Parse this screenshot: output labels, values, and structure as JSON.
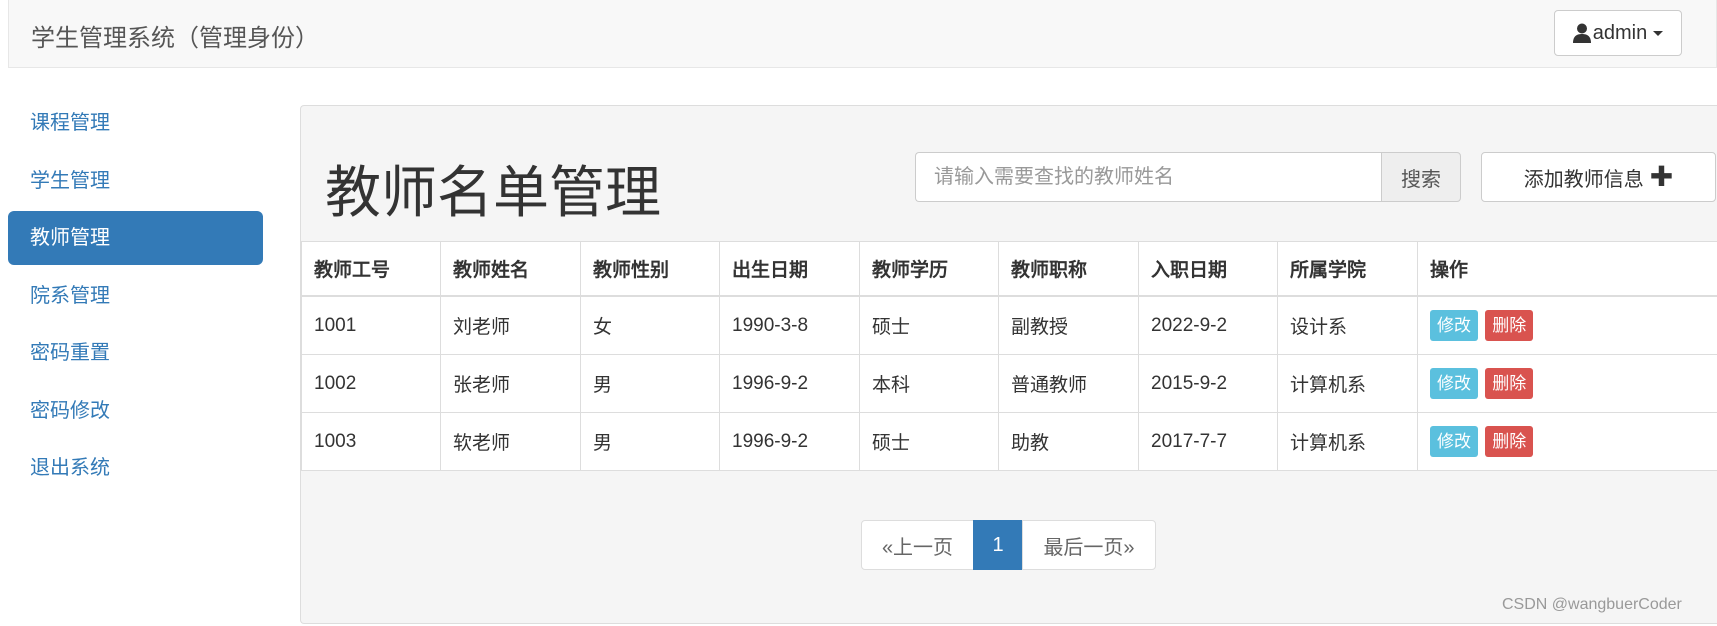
{
  "navbar": {
    "brand": "学生管理系统（管理身份）",
    "user": "admin"
  },
  "sidebar": {
    "items": [
      {
        "label": "课程管理"
      },
      {
        "label": "学生管理"
      },
      {
        "label": "教师管理",
        "active": true
      },
      {
        "label": "院系管理"
      },
      {
        "label": "密码重置"
      },
      {
        "label": "密码修改"
      },
      {
        "label": "退出系统"
      }
    ]
  },
  "main": {
    "title": "教师名单管理",
    "search": {
      "placeholder": "请输入需要查找的教师姓名",
      "value": "",
      "button": "搜索"
    },
    "add_button": "添加教师信息"
  },
  "table": {
    "headers": [
      "教师工号",
      "教师姓名",
      "教师性别",
      "出生日期",
      "教师学历",
      "教师职称",
      "入职日期",
      "所属学院",
      "操作"
    ],
    "rows": [
      [
        "1001",
        "刘老师",
        "女",
        "1990-3-8",
        "硕士",
        "副教授",
        "2022-9-2",
        "设计系"
      ],
      [
        "1002",
        "张老师",
        "男",
        "1996-9-2",
        "本科",
        "普通教师",
        "2015-9-2",
        "计算机系"
      ],
      [
        "1003",
        "软老师",
        "男",
        "1996-9-2",
        "硕士",
        "助教",
        "2017-7-7",
        "计算机系"
      ]
    ],
    "edit_label": "修改",
    "delete_label": "删除"
  },
  "pagination": {
    "prev": "«上一页",
    "current": "1",
    "last": "最后一页»"
  },
  "watermark": "CSDN @wangbuerCoder",
  "colors": {
    "primary": "#337ab7",
    "edit": "#5bc0de",
    "delete": "#d9534f"
  }
}
